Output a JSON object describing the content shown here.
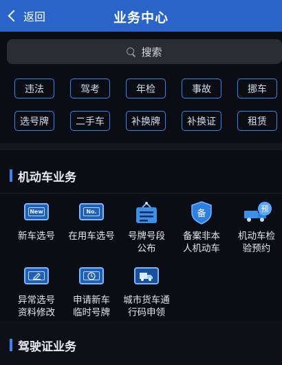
{
  "header": {
    "back_label": "返回",
    "title": "业务中心"
  },
  "search": {
    "placeholder": "搜索"
  },
  "quick_tags": [
    "违法",
    "驾考",
    "年检",
    "事故",
    "挪车",
    "选号牌",
    "二手车",
    "补换牌",
    "补换证",
    "租赁"
  ],
  "motor_section": {
    "title": "机动车业务",
    "items": [
      {
        "label_lines": [
          "新车选号"
        ],
        "icon": "new-plate-icon",
        "icon_text": "New"
      },
      {
        "label_lines": [
          "在用车选号"
        ],
        "icon": "used-plate-icon",
        "icon_text": "No."
      },
      {
        "label_lines": [
          "号牌号段",
          "公布"
        ],
        "icon": "announcement-board-icon"
      },
      {
        "label_lines": [
          "备案非本",
          "人机动车"
        ],
        "icon": "record-shield-icon",
        "icon_text": "备"
      },
      {
        "label_lines": [
          "机动车检",
          "验预约"
        ],
        "icon": "inspection-truck-icon",
        "icon_text": "预"
      },
      {
        "label_lines": [
          "异常选号",
          "资料修改"
        ],
        "icon": "edit-plate-icon"
      },
      {
        "label_lines": [
          "申请新车",
          "临时号牌"
        ],
        "icon": "temp-plate-clock-icon"
      },
      {
        "label_lines": [
          "城市货车通",
          "行码申领"
        ],
        "icon": "cargo-truck-icon"
      }
    ]
  },
  "license_section": {
    "title": "驾驶证业务"
  },
  "colors": {
    "header": "#2a64c9",
    "accent": "#3d83ee",
    "chip_border": "#3e86f0",
    "background": "#0a0d14"
  }
}
